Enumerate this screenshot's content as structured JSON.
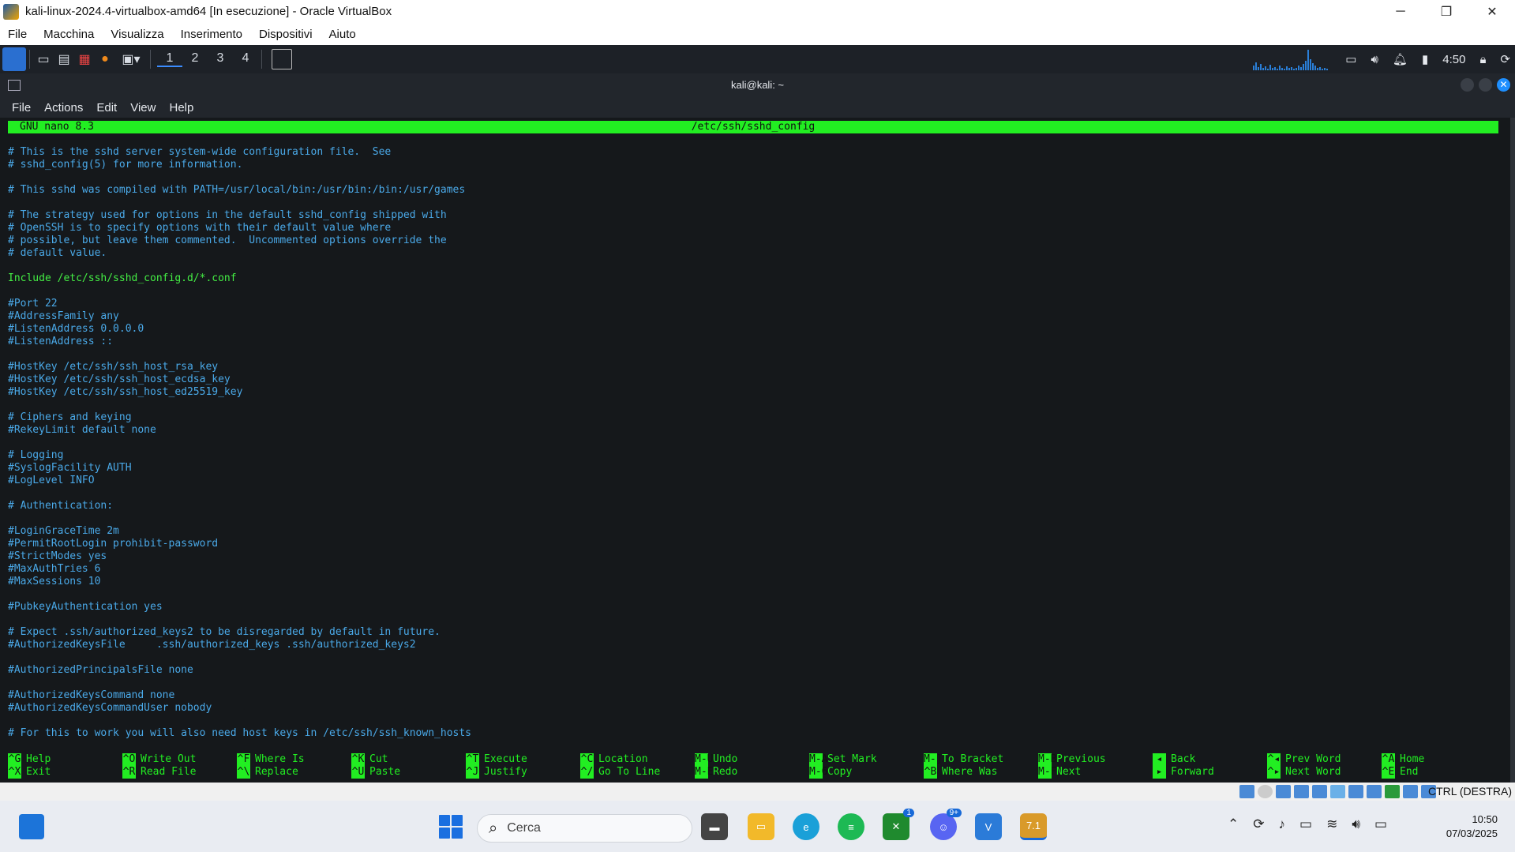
{
  "vbox": {
    "title": "kali-linux-2024.4-virtualbox-amd64 [In esecuzione] - Oracle VirtualBox",
    "menu": [
      "File",
      "Macchina",
      "Visualizza",
      "Inserimento",
      "Dispositivi",
      "Aiuto"
    ],
    "hostkey": "CTRL (DESTRA)"
  },
  "kali_panel": {
    "workspaces": [
      "1",
      "2",
      "3",
      "4"
    ],
    "active_workspace": "1",
    "time": "4:50"
  },
  "terminal": {
    "title": "kali@kali: ~",
    "menu": [
      "File",
      "Actions",
      "Edit",
      "View",
      "Help"
    ]
  },
  "nano": {
    "version": "GNU nano 8.3",
    "filename": "/etc/ssh/sshd_config",
    "lines": [
      "# This is the sshd server system-wide configuration file.  See",
      "# sshd_config(5) for more information.",
      "",
      "# This sshd was compiled with PATH=/usr/local/bin:/usr/bin:/bin:/usr/games",
      "",
      "# The strategy used for options in the default sshd_config shipped with",
      "# OpenSSH is to specify options with their default value where",
      "# possible, but leave them commented.  Uncommented options override the",
      "# default value.",
      "",
      "Include /etc/ssh/sshd_config.d/*.conf",
      "",
      "#Port 22",
      "#AddressFamily any",
      "#ListenAddress 0.0.0.0",
      "#ListenAddress ::",
      "",
      "#HostKey /etc/ssh/ssh_host_rsa_key",
      "#HostKey /etc/ssh/ssh_host_ecdsa_key",
      "#HostKey /etc/ssh/ssh_host_ed25519_key",
      "",
      "# Ciphers and keying",
      "#RekeyLimit default none",
      "",
      "# Logging",
      "#SyslogFacility AUTH",
      "#LogLevel INFO",
      "",
      "# Authentication:",
      "",
      "#LoginGraceTime 2m",
      "#PermitRootLogin prohibit-password",
      "#StrictModes yes",
      "#MaxAuthTries 6",
      "#MaxSessions 10",
      "",
      "#PubkeyAuthentication yes",
      "",
      "# Expect .ssh/authorized_keys2 to be disregarded by default in future.",
      "#AuthorizedKeysFile     .ssh/authorized_keys .ssh/authorized_keys2",
      "",
      "#AuthorizedPrincipalsFile none",
      "",
      "#AuthorizedKeysCommand none",
      "#AuthorizedKeysCommandUser nobody",
      "",
      "# For this to work you will also need host keys in /etc/ssh/ssh_known_hosts"
    ],
    "shortcuts": [
      {
        "k1": "^G",
        "l1": "Help",
        "k2": "^X",
        "l2": "Exit"
      },
      {
        "k1": "^O",
        "l1": "Write Out",
        "k2": "^R",
        "l2": "Read File"
      },
      {
        "k1": "^F",
        "l1": "Where Is",
        "k2": "^\\",
        "l2": "Replace"
      },
      {
        "k1": "^K",
        "l1": "Cut",
        "k2": "^U",
        "l2": "Paste"
      },
      {
        "k1": "^T",
        "l1": "Execute",
        "k2": "^J",
        "l2": "Justify"
      },
      {
        "k1": "^C",
        "l1": "Location",
        "k2": "^/",
        "l2": "Go To Line"
      },
      {
        "k1": "M-U",
        "l1": "Undo",
        "k2": "M-E",
        "l2": "Redo"
      },
      {
        "k1": "M-A",
        "l1": "Set Mark",
        "k2": "M-6",
        "l2": "Copy"
      },
      {
        "k1": "M-]",
        "l1": "To Bracket",
        "k2": "^B",
        "l2": "Where Was"
      },
      {
        "k1": "M-B",
        "l1": "Previous",
        "k2": "M-F",
        "l2": "Next"
      },
      {
        "k1": "◂",
        "l1": "Back",
        "k2": "▸",
        "l2": "Forward"
      },
      {
        "k1": "^◂",
        "l1": "Prev Word",
        "k2": "^▸",
        "l2": "Next Word"
      },
      {
        "k1": "^A",
        "l1": "Home",
        "k2": "^E",
        "l2": "End"
      }
    ]
  },
  "taskbar": {
    "search_placeholder": "Cerca",
    "xbox_badge": "1",
    "discord_badge": "9+",
    "vbox_label": "7.1",
    "time": "10:50",
    "date": "07/03/2025"
  }
}
